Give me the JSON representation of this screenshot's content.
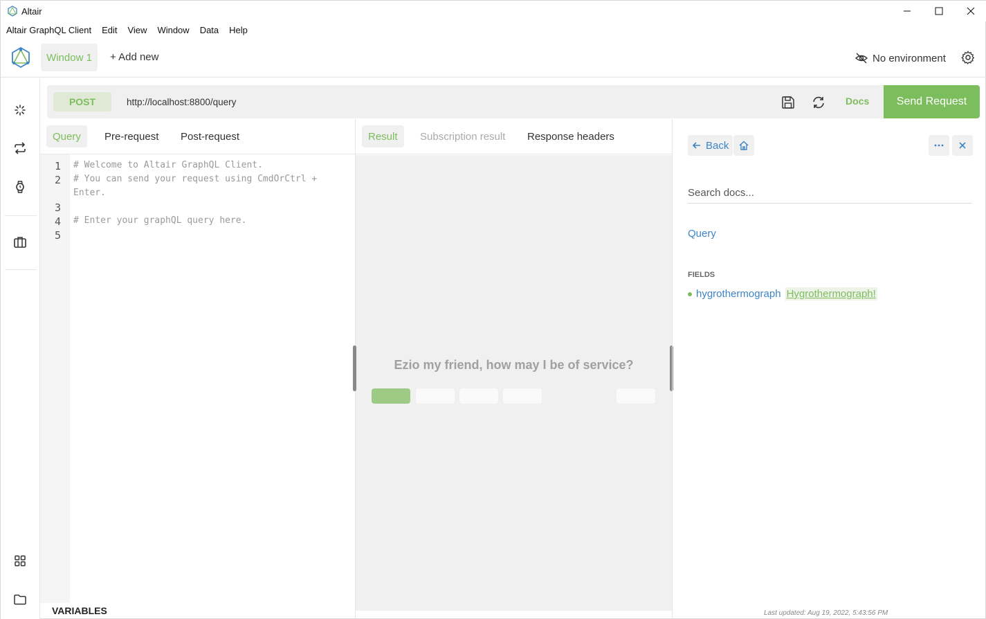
{
  "window": {
    "title": "Altair"
  },
  "menubar": {
    "items": [
      "Altair GraphQL Client",
      "Edit",
      "View",
      "Window",
      "Data",
      "Help"
    ]
  },
  "header": {
    "window_tab": "Window 1",
    "add_new": "+ Add new",
    "environment": "No environment"
  },
  "request": {
    "method": "POST",
    "url": "http://localhost:8800/query",
    "docs_label": "Docs",
    "send_label": "Send Request"
  },
  "query_pane": {
    "tabs": [
      "Query",
      "Pre-request",
      "Post-request"
    ],
    "line_numbers": [
      "1",
      "2",
      "3",
      "4",
      "5"
    ],
    "code_lines": [
      "# Welcome to Altair GraphQL Client.",
      "# You can send your request using CmdOrCtrl +",
      "Enter.",
      "",
      "# Enter your graphQL query here."
    ],
    "variables_label": "VARIABLES"
  },
  "result_pane": {
    "tabs": [
      "Result",
      "Subscription result",
      "Response headers"
    ],
    "welcome": "Ezio my friend, how may I be of service?"
  },
  "docs": {
    "back_label": "Back",
    "search_placeholder": "Search docs...",
    "root_query": "Query",
    "fields_label": "FIELDS",
    "fields": [
      {
        "name": "hygrothermograph",
        "type": "Hygrothermograph!"
      }
    ],
    "last_updated": "Last updated: Aug 19, 2022, 5:43:56 PM"
  },
  "colors": {
    "accent": "#7cbd5d",
    "link": "#3d85c6",
    "panel": "#f0f0f0"
  }
}
